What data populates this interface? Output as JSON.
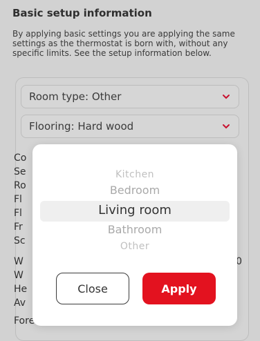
{
  "header": {
    "title": "Basic setup information",
    "description": "By applying basic settings you are applying the same settings as the thermostat is born with, without any specific limits. See the setup information below."
  },
  "dropdowns": {
    "room_type": "Room type: Other",
    "flooring": "Flooring: Hard wood"
  },
  "details_visible": {
    "line1": "Co",
    "line2": "Se",
    "line3": "Ro",
    "line4": "Fl",
    "line5": "Fl",
    "line6": "Fr",
    "line7": "Sc",
    "line8": "W",
    "line8_right": "0",
    "line9": "W",
    "line10": "He",
    "line11": "Av",
    "line12": "Forecast: Enabled"
  },
  "picker": {
    "options": [
      "Kitchen",
      "Bedroom",
      "Living room",
      "Bathroom",
      "Other"
    ],
    "selected": "Living room"
  },
  "buttons": {
    "close": "Close",
    "apply": "Apply"
  },
  "colors": {
    "accent": "#e3121f",
    "chevron": "#c8102e"
  }
}
